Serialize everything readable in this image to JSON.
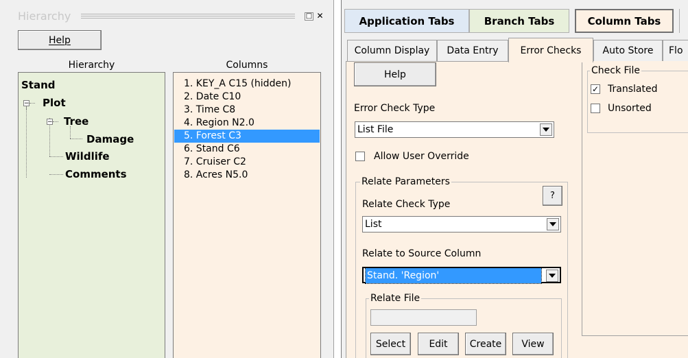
{
  "left": {
    "title": "Hierarchy",
    "help_label": "Help",
    "hierarchy_header": "Hierarchy",
    "columns_header": "Columns",
    "tree": {
      "stand": "Stand",
      "plot": "Plot",
      "tree": "Tree",
      "damage": "Damage",
      "wildlife": "Wildlife",
      "comments": "Comments",
      "expanded_glyph": "−"
    },
    "columns": [
      "1. KEY_A C15 (hidden)",
      "2. Date C10",
      "3. Time C8",
      "4. Region N2.0",
      "5. Forest C3",
      "6. Stand C6",
      "7. Cruiser C2",
      "8. Acres N5.0"
    ],
    "selected_column": "5. Forest C3",
    "restore_icon": "□",
    "close_icon": "✕"
  },
  "right": {
    "top_tabs": {
      "application": "Application Tabs",
      "branch": "Branch Tabs",
      "column": "Column Tabs"
    },
    "sub_tabs": {
      "column_display": "Column Display",
      "data_entry": "Data Entry",
      "error_checks": "Error Checks",
      "auto_store": "Auto Store",
      "fo": "Flo"
    },
    "help_label": "Help",
    "error_check_type_label": "Error Check Type",
    "error_check_type_value": "List File",
    "allow_user_override": "Allow User Override",
    "relate_parameters_title": "Relate Parameters",
    "question_label": "?",
    "relate_check_type_label": "Relate Check Type",
    "relate_check_type_value": "List",
    "relate_source_label": "Relate to Source Column",
    "relate_source_value": "Stand. 'Region'",
    "relate_file_title": "Relate File",
    "buttons": {
      "select": "Select",
      "edit": "Edit",
      "create": "Create",
      "view": "View"
    },
    "check_file_title": "Check File",
    "translated": "Translated",
    "unsorted": "Unsorted",
    "check_glyph": "✓"
  },
  "colors": {
    "hierarchy_bg": "#e8f0db",
    "columns_bg": "#fdf1e4",
    "selection": "#3399ff",
    "app_tab_bg": "#dfe9f5"
  }
}
